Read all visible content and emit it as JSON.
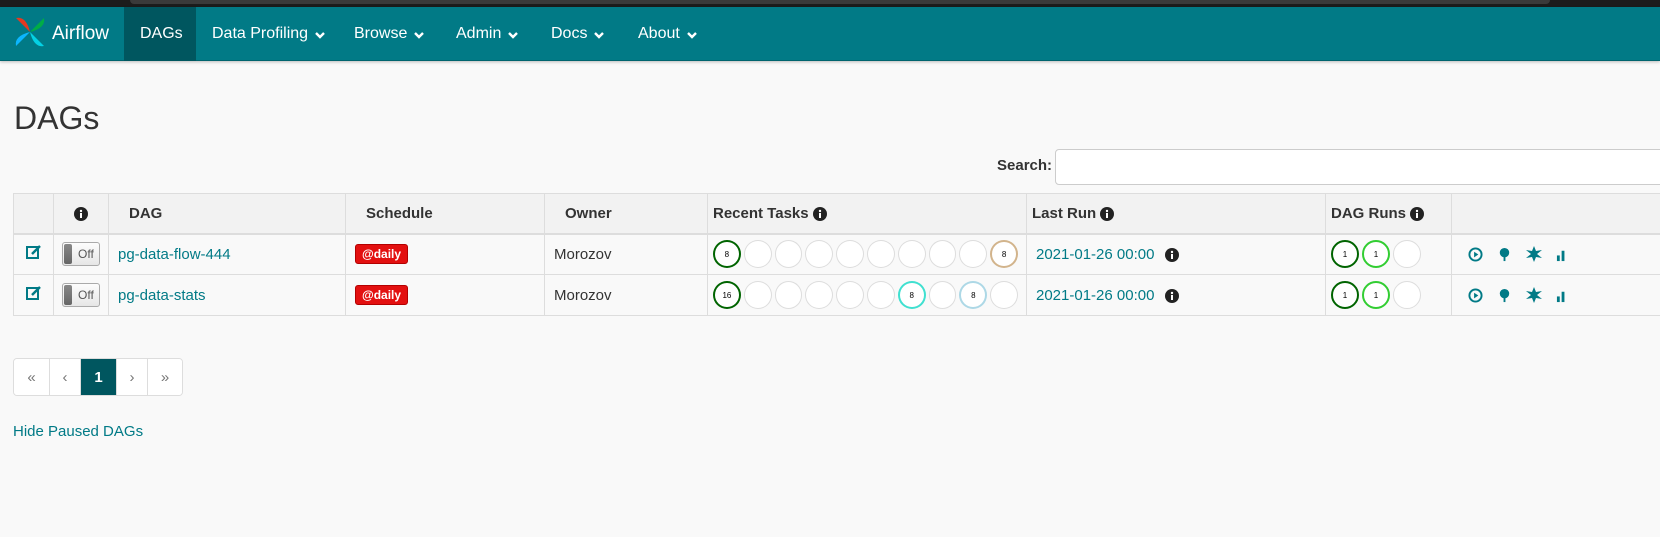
{
  "navbar": {
    "brand": "Airflow",
    "items": [
      {
        "label": "DAGs",
        "active": true
      },
      {
        "label": "Data Profiling",
        "dropdown": true
      },
      {
        "label": "Browse",
        "dropdown": true
      },
      {
        "label": "Admin",
        "dropdown": true
      },
      {
        "label": "Docs",
        "dropdown": true
      },
      {
        "label": "About",
        "dropdown": true
      }
    ]
  },
  "page": {
    "title": "DAGs",
    "search_label": "Search:",
    "search_value": ""
  },
  "table": {
    "headers": {
      "info": "",
      "dag": "DAG",
      "schedule": "Schedule",
      "owner": "Owner",
      "recent_tasks": "Recent Tasks",
      "last_run": "Last Run",
      "dag_runs": "DAG Runs"
    },
    "rows": [
      {
        "toggle": "Off",
        "dag": "pg-data-flow-444",
        "schedule": "@daily",
        "owner": "Morozov",
        "recent_tasks": [
          {
            "count": "8",
            "color": "#006400"
          },
          {
            "count": "",
            "color": ""
          },
          {
            "count": "",
            "color": ""
          },
          {
            "count": "",
            "color": ""
          },
          {
            "count": "",
            "color": ""
          },
          {
            "count": "",
            "color": ""
          },
          {
            "count": "",
            "color": ""
          },
          {
            "count": "",
            "color": ""
          },
          {
            "count": "",
            "color": ""
          },
          {
            "count": "8",
            "color": "#d2b48c"
          }
        ],
        "last_run": "2021-01-26 00:00",
        "dag_runs": [
          {
            "count": "1",
            "color": "#006400"
          },
          {
            "count": "1",
            "color": "#32cd32"
          },
          {
            "count": "",
            "color": ""
          }
        ]
      },
      {
        "toggle": "Off",
        "dag": "pg-data-stats",
        "schedule": "@daily",
        "owner": "Morozov",
        "recent_tasks": [
          {
            "count": "16",
            "color": "#006400"
          },
          {
            "count": "",
            "color": ""
          },
          {
            "count": "",
            "color": ""
          },
          {
            "count": "",
            "color": ""
          },
          {
            "count": "",
            "color": ""
          },
          {
            "count": "",
            "color": ""
          },
          {
            "count": "8",
            "color": "#40e0d0"
          },
          {
            "count": "",
            "color": ""
          },
          {
            "count": "8",
            "color": "#add8e6"
          },
          {
            "count": "",
            "color": ""
          }
        ],
        "last_run": "2021-01-26 00:00",
        "dag_runs": [
          {
            "count": "1",
            "color": "#006400"
          },
          {
            "count": "1",
            "color": "#32cd32"
          },
          {
            "count": "",
            "color": ""
          }
        ]
      }
    ]
  },
  "pagination": {
    "first": "«",
    "prev": "‹",
    "current": "1",
    "next": "›",
    "last": "»"
  },
  "footer": {
    "hide_paused": "Hide Paused DAGs"
  },
  "colors": {
    "navbar": "#017a86",
    "nav_active": "#00565f",
    "link": "#017a86",
    "daily_badge": "#e31010"
  }
}
